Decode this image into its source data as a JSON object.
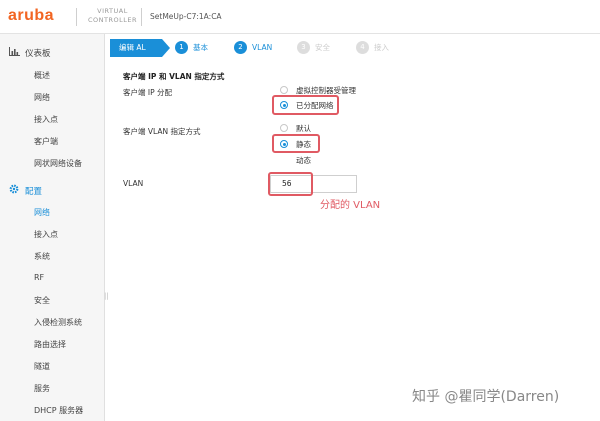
{
  "header": {
    "logo": "aruba",
    "product_line1": "VIRTUAL",
    "product_line2": "CONTROLLER",
    "controller_name": "SetMeUp-C7:1A:CA"
  },
  "sidebar": {
    "dashboard": {
      "label": "仪表板",
      "items": [
        "概述",
        "网络",
        "接入点",
        "客户端",
        "网状网络设备"
      ]
    },
    "config": {
      "label": "配置",
      "items": [
        "网络",
        "接入点",
        "系统",
        "RF",
        "安全",
        "入侵检测系统",
        "路由选择",
        "隧道",
        "服务",
        "DHCP 服务器"
      ],
      "active_item": "网络"
    }
  },
  "wizard": {
    "edit_label": "编辑 AL",
    "steps": [
      {
        "num": "1",
        "label": "基本"
      },
      {
        "num": "2",
        "label": "VLAN"
      },
      {
        "num": "3",
        "label": "安全"
      },
      {
        "num": "4",
        "label": "接入"
      }
    ]
  },
  "form": {
    "section_title": "客户端 IP 和 VLAN 指定方式",
    "ip_assignment": {
      "label": "客户端 IP 分配",
      "options": [
        "虚拟控制器受管理",
        "已分配网络"
      ],
      "selected": "已分配网络"
    },
    "vlan_assignment": {
      "label": "客户端 VLAN 指定方式",
      "options": [
        "默认",
        "静态",
        "动态"
      ],
      "selected": "静态"
    },
    "vlan": {
      "label": "VLAN",
      "value": "56"
    }
  },
  "annotation": "分配的 VLAN",
  "watermark": "知乎 @瞿同学(Darren)",
  "colors": {
    "brand_orange": "#f26522",
    "accent_blue": "#1a8fd8",
    "highlight_red": "#e05a63"
  }
}
